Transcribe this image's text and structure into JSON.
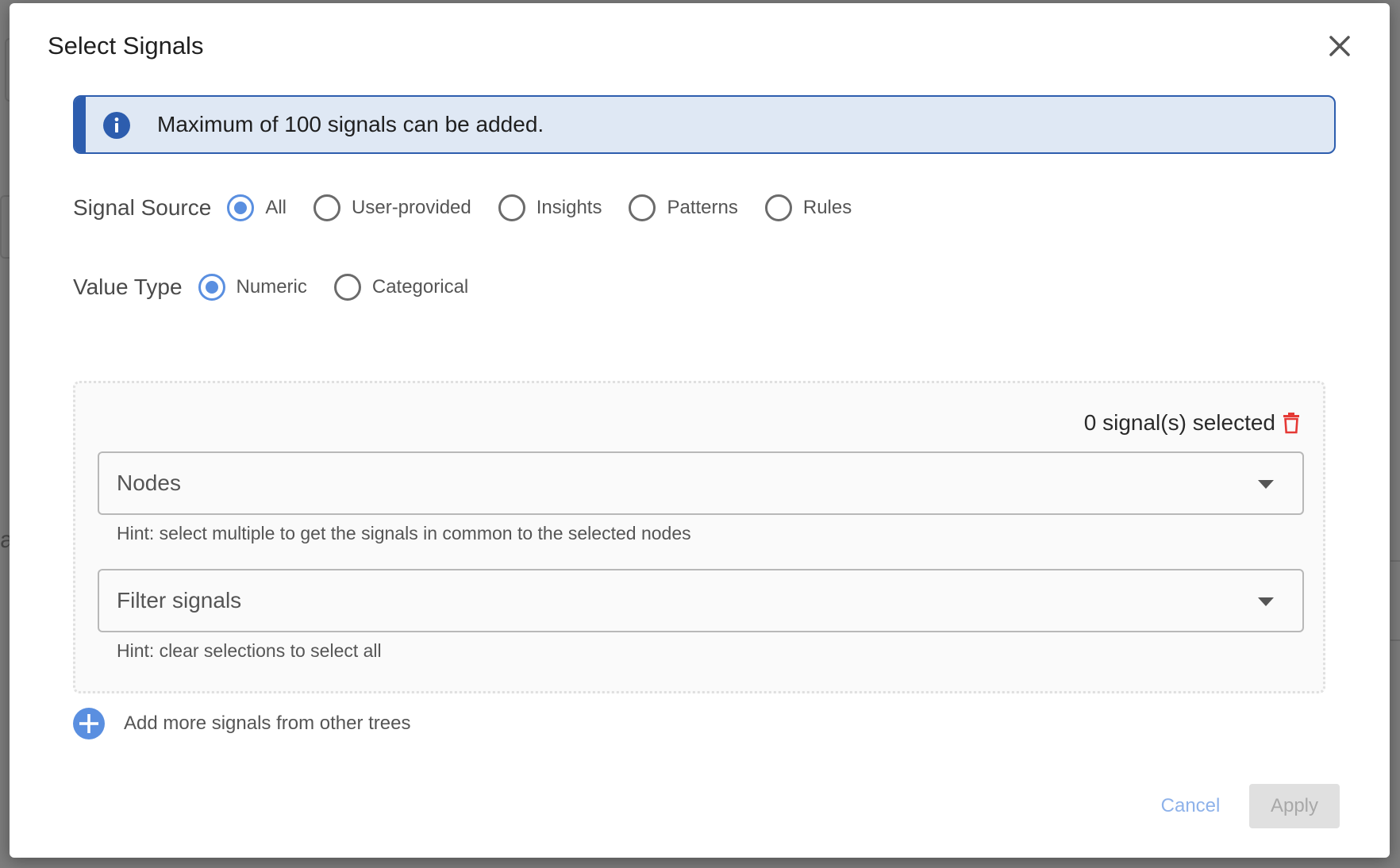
{
  "dialog": {
    "title": "Select Signals",
    "close_icon": "close-icon"
  },
  "info": {
    "icon": "info-icon",
    "message": "Maximum of 100 signals can be added."
  },
  "signal_source": {
    "label": "Signal Source",
    "options": [
      {
        "label": "All",
        "checked": true
      },
      {
        "label": "User-provided",
        "checked": false
      },
      {
        "label": "Insights",
        "checked": false
      },
      {
        "label": "Patterns",
        "checked": false
      },
      {
        "label": "Rules",
        "checked": false
      }
    ]
  },
  "value_type": {
    "label": "Value Type",
    "options": [
      {
        "label": "Numeric",
        "checked": true
      },
      {
        "label": "Categorical",
        "checked": false
      }
    ]
  },
  "selection": {
    "count_text": "0 signal(s) selected",
    "delete_icon": "trash-icon",
    "nodes_placeholder": "Nodes",
    "nodes_hint": "Hint: select multiple to get the signals in common to the selected nodes",
    "filter_placeholder": "Filter signals",
    "filter_hint": "Hint: clear selections to select all"
  },
  "add_more": {
    "icon": "plus-circle-icon",
    "label": "Add more signals from other trees"
  },
  "footer": {
    "cancel_label": "Cancel",
    "apply_label": "Apply",
    "apply_disabled": true
  },
  "colors": {
    "accent": "#5a8fe0",
    "info_border": "#2d5dae",
    "info_bg": "#dfe8f4",
    "danger": "#e53935",
    "disabled_bg": "#e0e0e0"
  }
}
